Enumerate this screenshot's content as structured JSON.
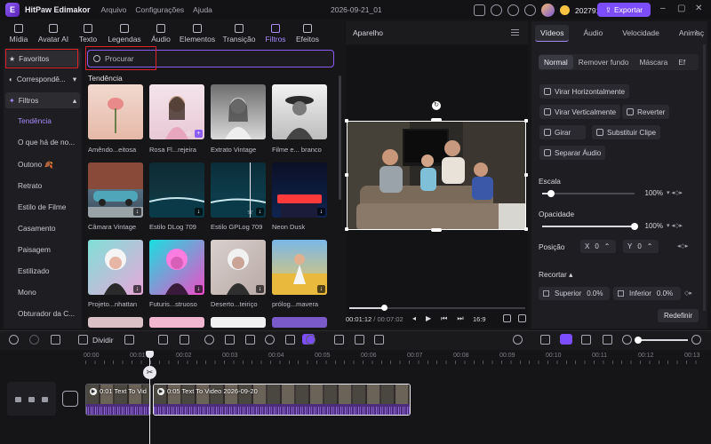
{
  "titlebar": {
    "app_name": "HitPaw Edimakor",
    "menu": [
      "Arquivo",
      "Configurações",
      "Ajuda"
    ],
    "doc_title": "2026-09-21_01",
    "credits": "202791",
    "export_label": "Exportar"
  },
  "left_tabs": [
    {
      "label": "Mídia"
    },
    {
      "label": "Avatar AI"
    },
    {
      "label": "Texto"
    },
    {
      "label": "Legendas"
    },
    {
      "label": "Áudio"
    },
    {
      "label": "Elementos"
    },
    {
      "label": "Transição"
    },
    {
      "label": "Filtros"
    },
    {
      "label": "Efeitos"
    }
  ],
  "sidebar": {
    "favoritos": "Favoritos",
    "correspondence": "Correspondê...",
    "filtros": "Filtros",
    "items": [
      "Tendência",
      "O que há de no...",
      "Outono 🍂",
      "Retrato",
      "Estilo de Filme",
      "Casamento",
      "Paisagem",
      "Estilizado",
      "Mono",
      "Obturador da C..."
    ]
  },
  "search": {
    "placeholder": "Procurar"
  },
  "section_title": "Tendência",
  "filters": [
    {
      "label": "Amêndo...eitosa"
    },
    {
      "label": "Rosa Fl...rejeira"
    },
    {
      "label": "Extrato Vintage"
    },
    {
      "label": "Filme e... branco"
    },
    {
      "label": "Câmara Vintage"
    },
    {
      "label": "Estilo DLog 709"
    },
    {
      "label": "Estilo GPLog 709"
    },
    {
      "label": "Neon Dusk"
    },
    {
      "label": "Projeto...nhattan"
    },
    {
      "label": "Futuris...struoso"
    },
    {
      "label": "Deserto...teiriço"
    },
    {
      "label": "prólog...mavera"
    }
  ],
  "preview": {
    "title": "Aparelho",
    "current_time": "00:01:12",
    "total_time": "/ 00:07:02",
    "ratio": "16:9",
    "progress": 0.2
  },
  "right_panel": {
    "tabs": [
      "Vídeos",
      "Áudio",
      "Velocidade",
      "Animaç"
    ],
    "subtabs": [
      "Normal",
      "Remover fundo",
      "Máscara",
      "Ef"
    ],
    "buttons": {
      "flip_h": "Virar Horizontalmente",
      "flip_v": "Virar Verticalmente",
      "reverse": "Reverter",
      "rotate": "Girar",
      "replace": "Substituir Clipe",
      "separate": "Separar Áudio"
    },
    "scale": {
      "label": "Escala",
      "value": "100%",
      "level": 0.1
    },
    "opacity": {
      "label": "Opacidade",
      "value": "100%",
      "level": 1.0
    },
    "position": {
      "label": "Posição",
      "x_label": "X",
      "x_value": "0",
      "y_label": "Y",
      "y_value": "0"
    },
    "crop": {
      "label": "Recortar",
      "top_label": "Superior",
      "top_value": "0.0%",
      "bottom_label": "Inferior",
      "bottom_value": "0.0%"
    },
    "reset": "Redefinir"
  },
  "timeline": {
    "split_label": "Dividir",
    "ruler": [
      "00:00",
      "00:01",
      "00:02",
      "00:03",
      "00:04",
      "00:05",
      "00:06",
      "00:07",
      "00:08",
      "00:09",
      "00:10",
      "00:11",
      "00:12",
      "00:13"
    ],
    "clips": [
      {
        "title": "0:01 Text To Vid"
      },
      {
        "title": "0:05 Text To Video 2026-09-20"
      }
    ]
  }
}
